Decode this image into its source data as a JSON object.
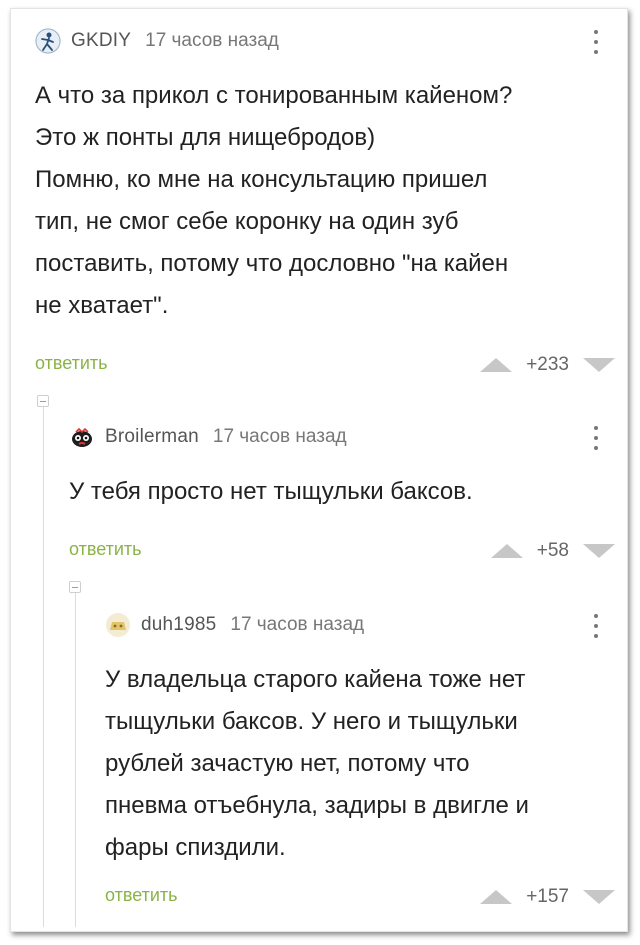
{
  "comments": [
    {
      "nick": "GKDIY",
      "time": "17 часов назад",
      "text": "А что за прикол с тонированным кайеном?\nЭто ж понты для нищебродов)\nПомню, ко мне на консультацию пришел\nтип, не смог себе коронку на один зуб\nпоставить, потому что дословно \"на кайен\nне хватает\".",
      "reply": "ответить",
      "rating": "+233"
    },
    {
      "nick": "Broilerman",
      "time": "17 часов назад",
      "text": "У тебя просто нет тыщульки баксов.",
      "reply": "ответить",
      "rating": "+58"
    },
    {
      "nick": "duh1985",
      "time": "17 часов назад",
      "text": "У владельца старого кайена тоже нет\nтыщульки баксов. У него и тыщульки\nрублей зачастую нет, потому что\nпневма отъебнула, задиры в двигле и\nфары спиздили.",
      "reply": "ответить",
      "rating": "+157"
    }
  ],
  "colors": {
    "reply": "#8ab346",
    "arrows": "#c7c7c7",
    "meta": "#777777"
  },
  "icons": [
    "user-avatar-icon",
    "more-dots-icon",
    "upvote-icon",
    "downvote-icon",
    "collapse-branch-icon"
  ]
}
